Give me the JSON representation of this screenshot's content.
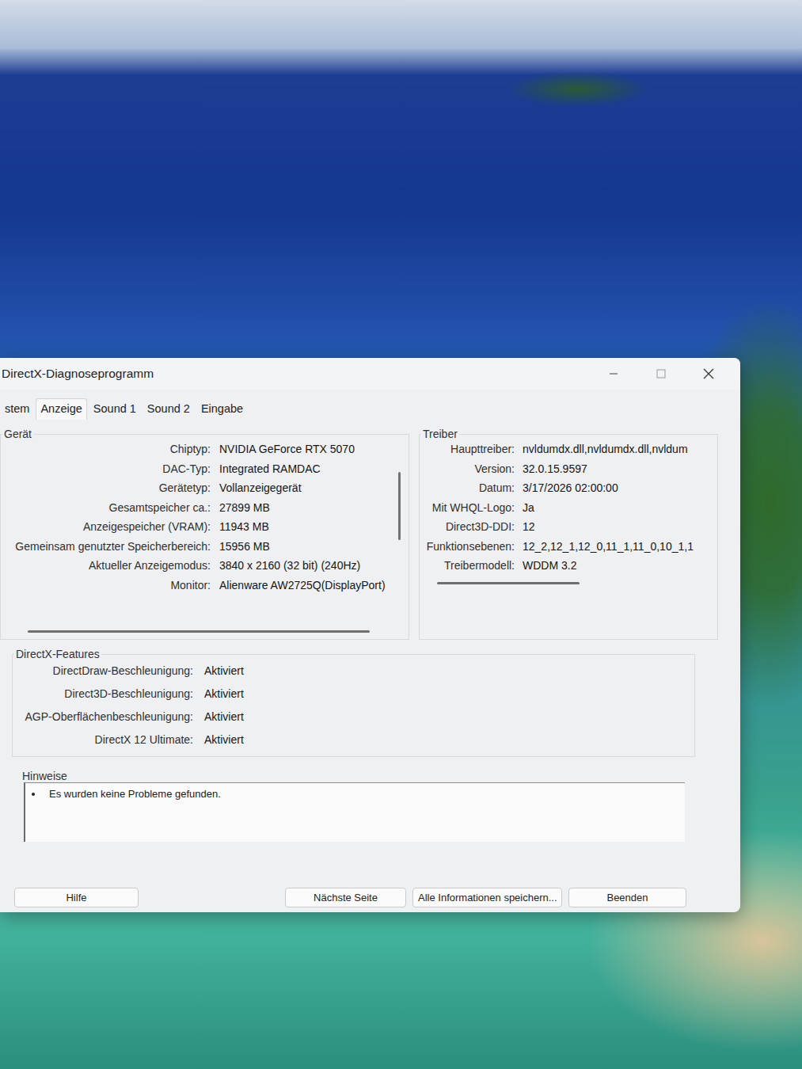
{
  "window": {
    "title": "DirectX-Diagnoseprogramm"
  },
  "tabs": [
    {
      "label": "stem",
      "selected": false
    },
    {
      "label": "Anzeige",
      "selected": true
    },
    {
      "label": "Sound 1",
      "selected": false
    },
    {
      "label": "Sound 2",
      "selected": false
    },
    {
      "label": "Eingabe",
      "selected": false
    }
  ],
  "device": {
    "title": "Gerät",
    "vscroll": 0.45,
    "hscroll": 0.95,
    "rows": [
      {
        "label": "Chiptyp:",
        "value": "NVIDIA GeForce RTX 5070"
      },
      {
        "label": "DAC-Typ:",
        "value": "Integrated RAMDAC"
      },
      {
        "label": "Gerätetyp:",
        "value": "Vollanzeigegerät"
      },
      {
        "label": "Gesamtspeicher ca.:",
        "value": "27899 MB"
      },
      {
        "label": "Anzeigespeicher (VRAM):",
        "value": "11943 MB"
      },
      {
        "label": "Gemeinsam genutzter Speicherbereich:",
        "value": "15956 MB"
      },
      {
        "label": "Aktueller Anzeigemodus:",
        "value": "3840 x 2160 (32 bit) (240Hz)"
      },
      {
        "label": "Monitor:",
        "value": "Alienware AW2725Q(DisplayPort)"
      }
    ]
  },
  "driver": {
    "title": "Treiber",
    "hscroll": 0.55,
    "rows": [
      {
        "label": "Haupttreiber:",
        "value": "nvldumdx.dll,nvldumdx.dll,nvldum"
      },
      {
        "label": "Version:",
        "value": "32.0.15.9597"
      },
      {
        "label": "Datum:",
        "value": "3/17/2026 02:00:00"
      },
      {
        "label": "Mit WHQL-Logo:",
        "value": "Ja"
      },
      {
        "label": "Direct3D-DDI:",
        "value": "12"
      },
      {
        "label": "Funktionsebenen:",
        "value": "12_2,12_1,12_0,11_1,11_0,10_1,1"
      },
      {
        "label": "Treibermodell:",
        "value": "WDDM 3.2"
      }
    ]
  },
  "features": {
    "title": "DirectX-Features",
    "rows": [
      {
        "label": "DirectDraw-Beschleunigung:",
        "value": "Aktiviert"
      },
      {
        "label": "Direct3D-Beschleunigung:",
        "value": "Aktiviert"
      },
      {
        "label": "AGP-Oberflächenbeschleunigung:",
        "value": "Aktiviert"
      },
      {
        "label": "DirectX 12 Ultimate:",
        "value": "Aktiviert"
      }
    ]
  },
  "notes": {
    "title": "Hinweise",
    "items": [
      "Es wurden keine Probleme gefunden."
    ]
  },
  "buttons": [
    "Hilfe",
    "Nächste Seite",
    "Alle Informationen speichern...",
    "Beenden"
  ]
}
